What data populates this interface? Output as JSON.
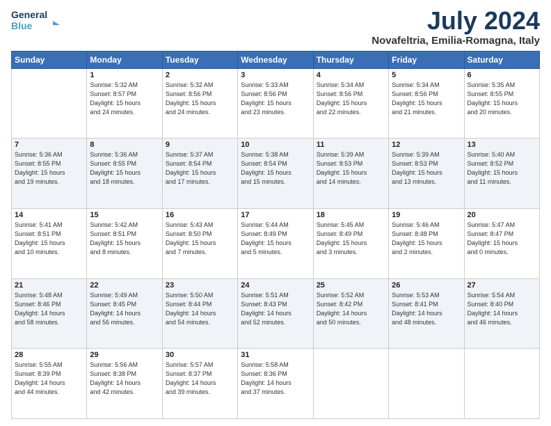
{
  "logo": {
    "line1": "General",
    "line2": "Blue"
  },
  "title": "July 2024",
  "location": "Novafeltria, Emilia-Romagna, Italy",
  "days_of_week": [
    "Sunday",
    "Monday",
    "Tuesday",
    "Wednesday",
    "Thursday",
    "Friday",
    "Saturday"
  ],
  "weeks": [
    [
      {
        "day": "",
        "info": ""
      },
      {
        "day": "1",
        "info": "Sunrise: 5:32 AM\nSunset: 8:57 PM\nDaylight: 15 hours\nand 24 minutes."
      },
      {
        "day": "2",
        "info": "Sunrise: 5:32 AM\nSunset: 8:56 PM\nDaylight: 15 hours\nand 24 minutes."
      },
      {
        "day": "3",
        "info": "Sunrise: 5:33 AM\nSunset: 8:56 PM\nDaylight: 15 hours\nand 23 minutes."
      },
      {
        "day": "4",
        "info": "Sunrise: 5:34 AM\nSunset: 8:56 PM\nDaylight: 15 hours\nand 22 minutes."
      },
      {
        "day": "5",
        "info": "Sunrise: 5:34 AM\nSunset: 8:56 PM\nDaylight: 15 hours\nand 21 minutes."
      },
      {
        "day": "6",
        "info": "Sunrise: 5:35 AM\nSunset: 8:55 PM\nDaylight: 15 hours\nand 20 minutes."
      }
    ],
    [
      {
        "day": "7",
        "info": "Sunrise: 5:36 AM\nSunset: 8:55 PM\nDaylight: 15 hours\nand 19 minutes."
      },
      {
        "day": "8",
        "info": "Sunrise: 5:36 AM\nSunset: 8:55 PM\nDaylight: 15 hours\nand 18 minutes."
      },
      {
        "day": "9",
        "info": "Sunrise: 5:37 AM\nSunset: 8:54 PM\nDaylight: 15 hours\nand 17 minutes."
      },
      {
        "day": "10",
        "info": "Sunrise: 5:38 AM\nSunset: 8:54 PM\nDaylight: 15 hours\nand 15 minutes."
      },
      {
        "day": "11",
        "info": "Sunrise: 5:39 AM\nSunset: 8:53 PM\nDaylight: 15 hours\nand 14 minutes."
      },
      {
        "day": "12",
        "info": "Sunrise: 5:39 AM\nSunset: 8:53 PM\nDaylight: 15 hours\nand 13 minutes."
      },
      {
        "day": "13",
        "info": "Sunrise: 5:40 AM\nSunset: 8:52 PM\nDaylight: 15 hours\nand 11 minutes."
      }
    ],
    [
      {
        "day": "14",
        "info": "Sunrise: 5:41 AM\nSunset: 8:51 PM\nDaylight: 15 hours\nand 10 minutes."
      },
      {
        "day": "15",
        "info": "Sunrise: 5:42 AM\nSunset: 8:51 PM\nDaylight: 15 hours\nand 8 minutes."
      },
      {
        "day": "16",
        "info": "Sunrise: 5:43 AM\nSunset: 8:50 PM\nDaylight: 15 hours\nand 7 minutes."
      },
      {
        "day": "17",
        "info": "Sunrise: 5:44 AM\nSunset: 8:49 PM\nDaylight: 15 hours\nand 5 minutes."
      },
      {
        "day": "18",
        "info": "Sunrise: 5:45 AM\nSunset: 8:49 PM\nDaylight: 15 hours\nand 3 minutes."
      },
      {
        "day": "19",
        "info": "Sunrise: 5:46 AM\nSunset: 8:48 PM\nDaylight: 15 hours\nand 2 minutes."
      },
      {
        "day": "20",
        "info": "Sunrise: 5:47 AM\nSunset: 8:47 PM\nDaylight: 15 hours\nand 0 minutes."
      }
    ],
    [
      {
        "day": "21",
        "info": "Sunrise: 5:48 AM\nSunset: 8:46 PM\nDaylight: 14 hours\nand 58 minutes."
      },
      {
        "day": "22",
        "info": "Sunrise: 5:49 AM\nSunset: 8:45 PM\nDaylight: 14 hours\nand 56 minutes."
      },
      {
        "day": "23",
        "info": "Sunrise: 5:50 AM\nSunset: 8:44 PM\nDaylight: 14 hours\nand 54 minutes."
      },
      {
        "day": "24",
        "info": "Sunrise: 5:51 AM\nSunset: 8:43 PM\nDaylight: 14 hours\nand 52 minutes."
      },
      {
        "day": "25",
        "info": "Sunrise: 5:52 AM\nSunset: 8:42 PM\nDaylight: 14 hours\nand 50 minutes."
      },
      {
        "day": "26",
        "info": "Sunrise: 5:53 AM\nSunset: 8:41 PM\nDaylight: 14 hours\nand 48 minutes."
      },
      {
        "day": "27",
        "info": "Sunrise: 5:54 AM\nSunset: 8:40 PM\nDaylight: 14 hours\nand 46 minutes."
      }
    ],
    [
      {
        "day": "28",
        "info": "Sunrise: 5:55 AM\nSunset: 8:39 PM\nDaylight: 14 hours\nand 44 minutes."
      },
      {
        "day": "29",
        "info": "Sunrise: 5:56 AM\nSunset: 8:38 PM\nDaylight: 14 hours\nand 42 minutes."
      },
      {
        "day": "30",
        "info": "Sunrise: 5:57 AM\nSunset: 8:37 PM\nDaylight: 14 hours\nand 39 minutes."
      },
      {
        "day": "31",
        "info": "Sunrise: 5:58 AM\nSunset: 8:36 PM\nDaylight: 14 hours\nand 37 minutes."
      },
      {
        "day": "",
        "info": ""
      },
      {
        "day": "",
        "info": ""
      },
      {
        "day": "",
        "info": ""
      }
    ]
  ]
}
